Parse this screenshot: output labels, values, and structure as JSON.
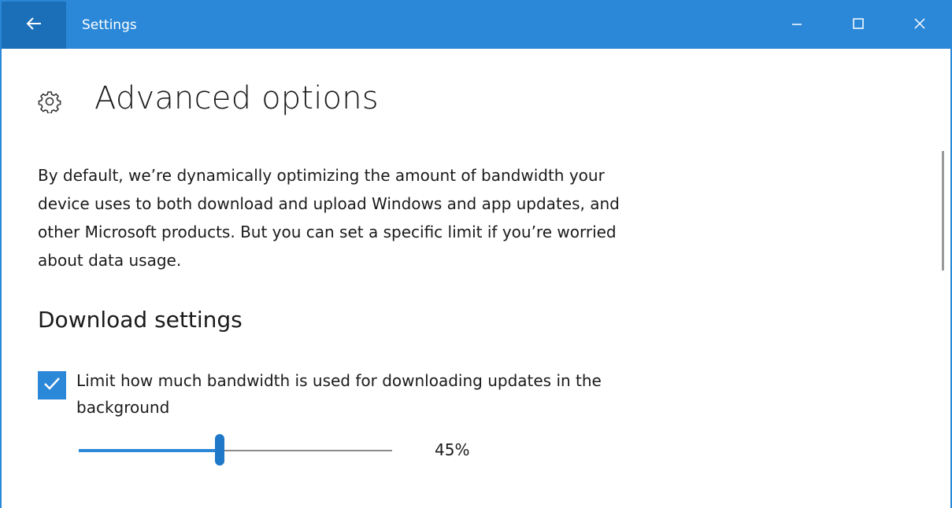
{
  "window": {
    "title": "Settings"
  },
  "titlebar": {
    "back_icon": "arrow-left-icon",
    "minimize_icon": "minimize-icon",
    "maximize_icon": "maximize-icon",
    "close_icon": "close-icon"
  },
  "page": {
    "icon": "gear-icon",
    "title": "Advanced options",
    "description": "By default, we’re dynamically optimizing the amount of bandwidth your device uses to both download and upload Windows and app updates, and other Microsoft products. But you can set a specific limit if you’re worried about data usage."
  },
  "download_settings": {
    "heading": "Download settings",
    "limit_checkbox": {
      "checked": true,
      "label": "Limit how much bandwidth is used for downloading updates in the background"
    },
    "bandwidth_slider": {
      "value": 45,
      "value_text": "45%"
    }
  },
  "colors": {
    "accent": "#2b88d8",
    "back_button_bg": "#1a6fb8",
    "text": "#1a1a1a"
  }
}
